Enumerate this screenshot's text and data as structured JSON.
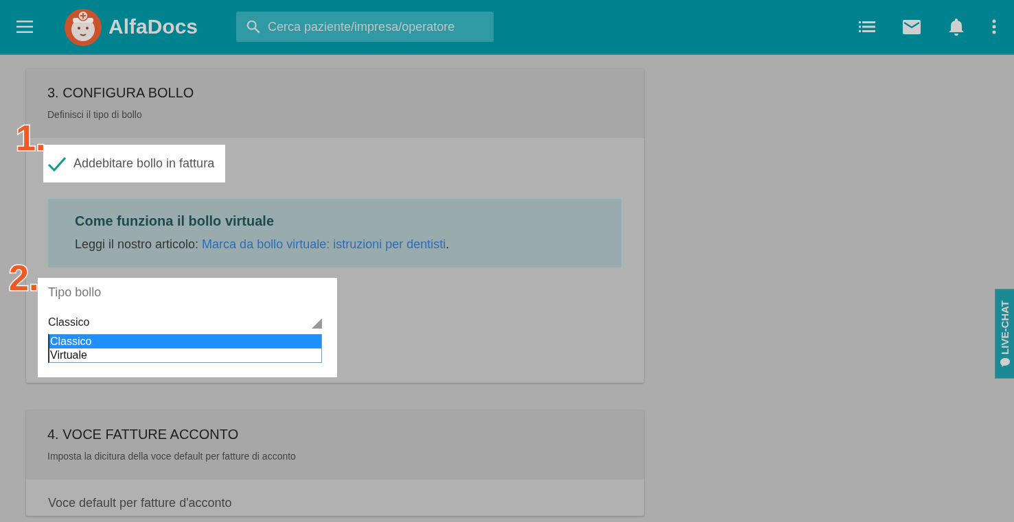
{
  "topbar": {
    "logo_text": "AlfaDocs",
    "search": {
      "placeholder": "Cerca paziente/impresa/operatore"
    }
  },
  "sections": [
    {
      "title": "3. CONFIGURA BOLLO",
      "subtitle": "Definisci il tipo di bollo",
      "checkbox": {
        "label": "Addebitare bollo in fattura",
        "checked": true,
        "annotation": "1."
      },
      "info": {
        "title": "Come funziona il bollo virtuale",
        "text": "Leggi il nostro articolo: ",
        "link": "Marca da bollo virtuale: istruzioni per dentisti",
        "after": "."
      },
      "select": {
        "label": "Tipo bollo",
        "value": "Classico",
        "annotation": "2.",
        "options": [
          {
            "label": "Classico",
            "selected": true
          },
          {
            "label": "Virtuale",
            "selected": false
          }
        ]
      }
    },
    {
      "title": "4. VOCE FATTURE ACCONTO",
      "subtitle": "Imposta la dicitura della voce default per fatture di acconto",
      "field": {
        "label": "Voce default per fatture d'acconto"
      }
    }
  ],
  "live_chat": {
    "label": "LIVE-CHAT"
  }
}
